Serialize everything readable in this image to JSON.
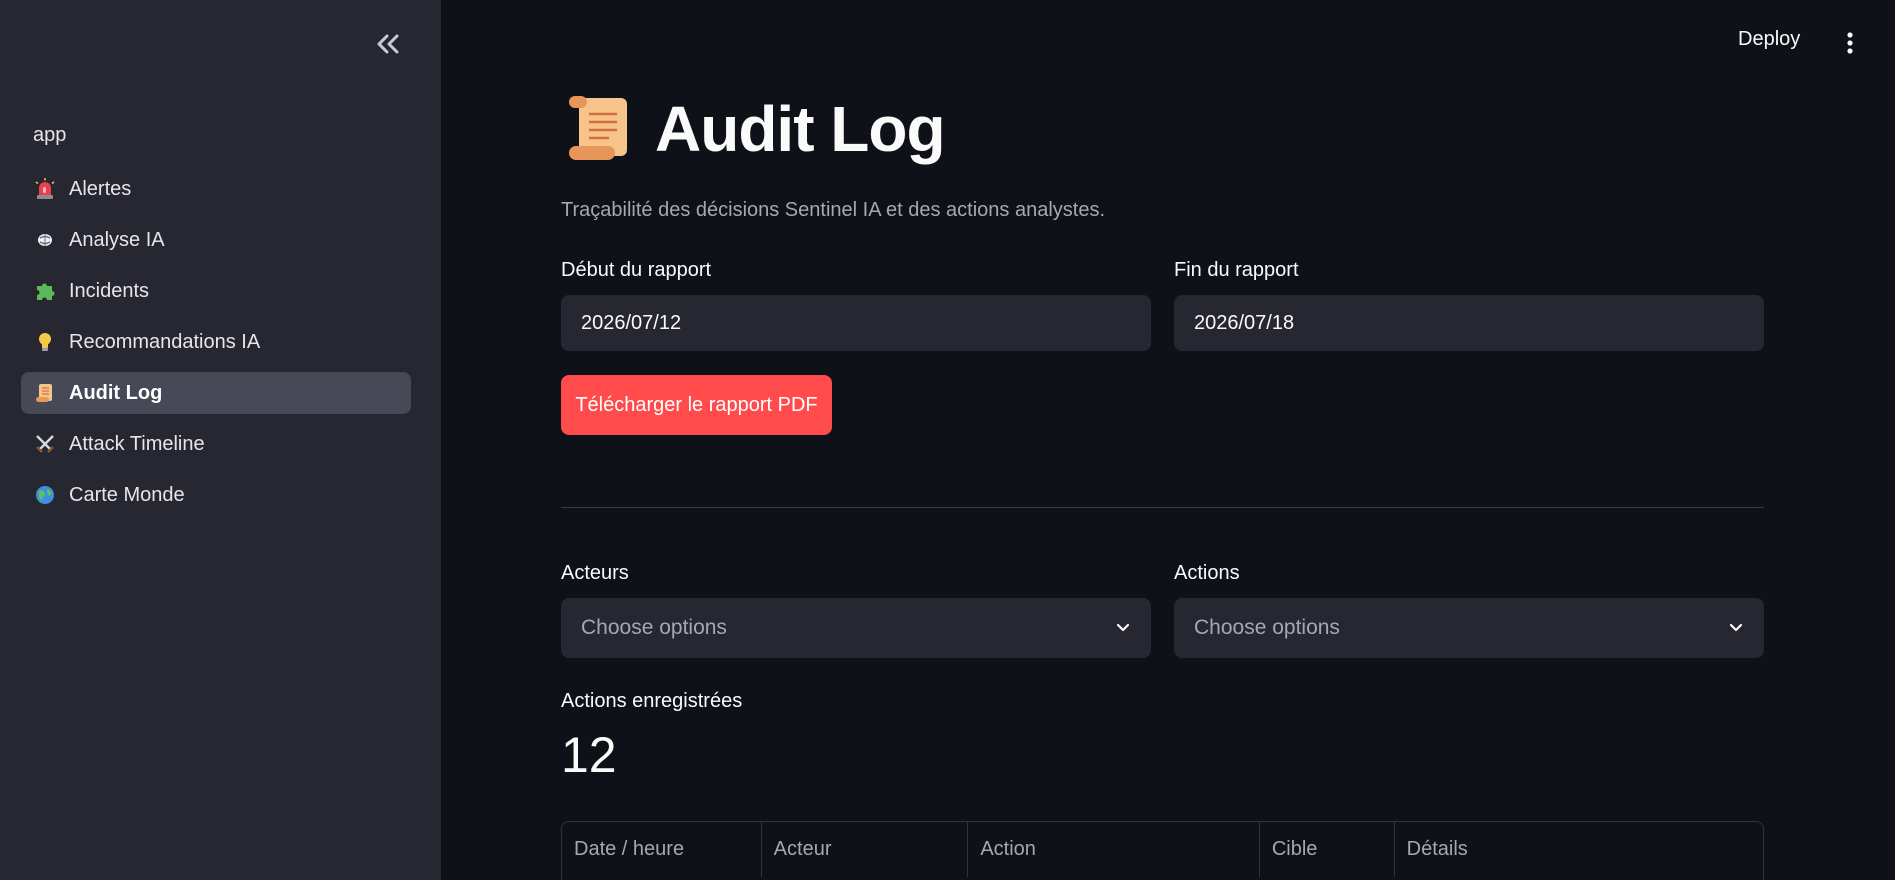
{
  "sidebar": {
    "header": "app",
    "items": [
      {
        "label": "Alertes",
        "icon": "siren-icon"
      },
      {
        "label": "Analyse IA",
        "icon": "brain-icon"
      },
      {
        "label": "Incidents",
        "icon": "puzzle-icon"
      },
      {
        "label": "Recommandations IA",
        "icon": "lightbulb-icon"
      },
      {
        "label": "Audit Log",
        "icon": "scroll-icon",
        "active": true
      },
      {
        "label": "Attack Timeline",
        "icon": "crossed-swords-icon"
      },
      {
        "label": "Carte Monde",
        "icon": "globe-icon"
      }
    ]
  },
  "topbar": {
    "deploy_label": "Deploy"
  },
  "page": {
    "title": "Audit Log",
    "subtitle": "Traçabilité des décisions Sentinel IA et des actions analystes."
  },
  "report": {
    "start_label": "Début du rapport",
    "start_value": "2026/07/12",
    "end_label": "Fin du rapport",
    "end_value": "2026/07/18",
    "download_label": "Télécharger le rapport PDF"
  },
  "filters": {
    "actors_label": "Acteurs",
    "actors_placeholder": "Choose options",
    "actions_label": "Actions",
    "actions_placeholder": "Choose options"
  },
  "metric": {
    "label": "Actions enregistrées",
    "value": "12"
  },
  "table": {
    "columns": [
      "Date / heure",
      "Acteur",
      "Action",
      "Cible",
      "Détails"
    ]
  },
  "colors": {
    "accent": "#ff4b4b",
    "sidebar_bg": "#262730",
    "main_bg": "#0e1117"
  }
}
